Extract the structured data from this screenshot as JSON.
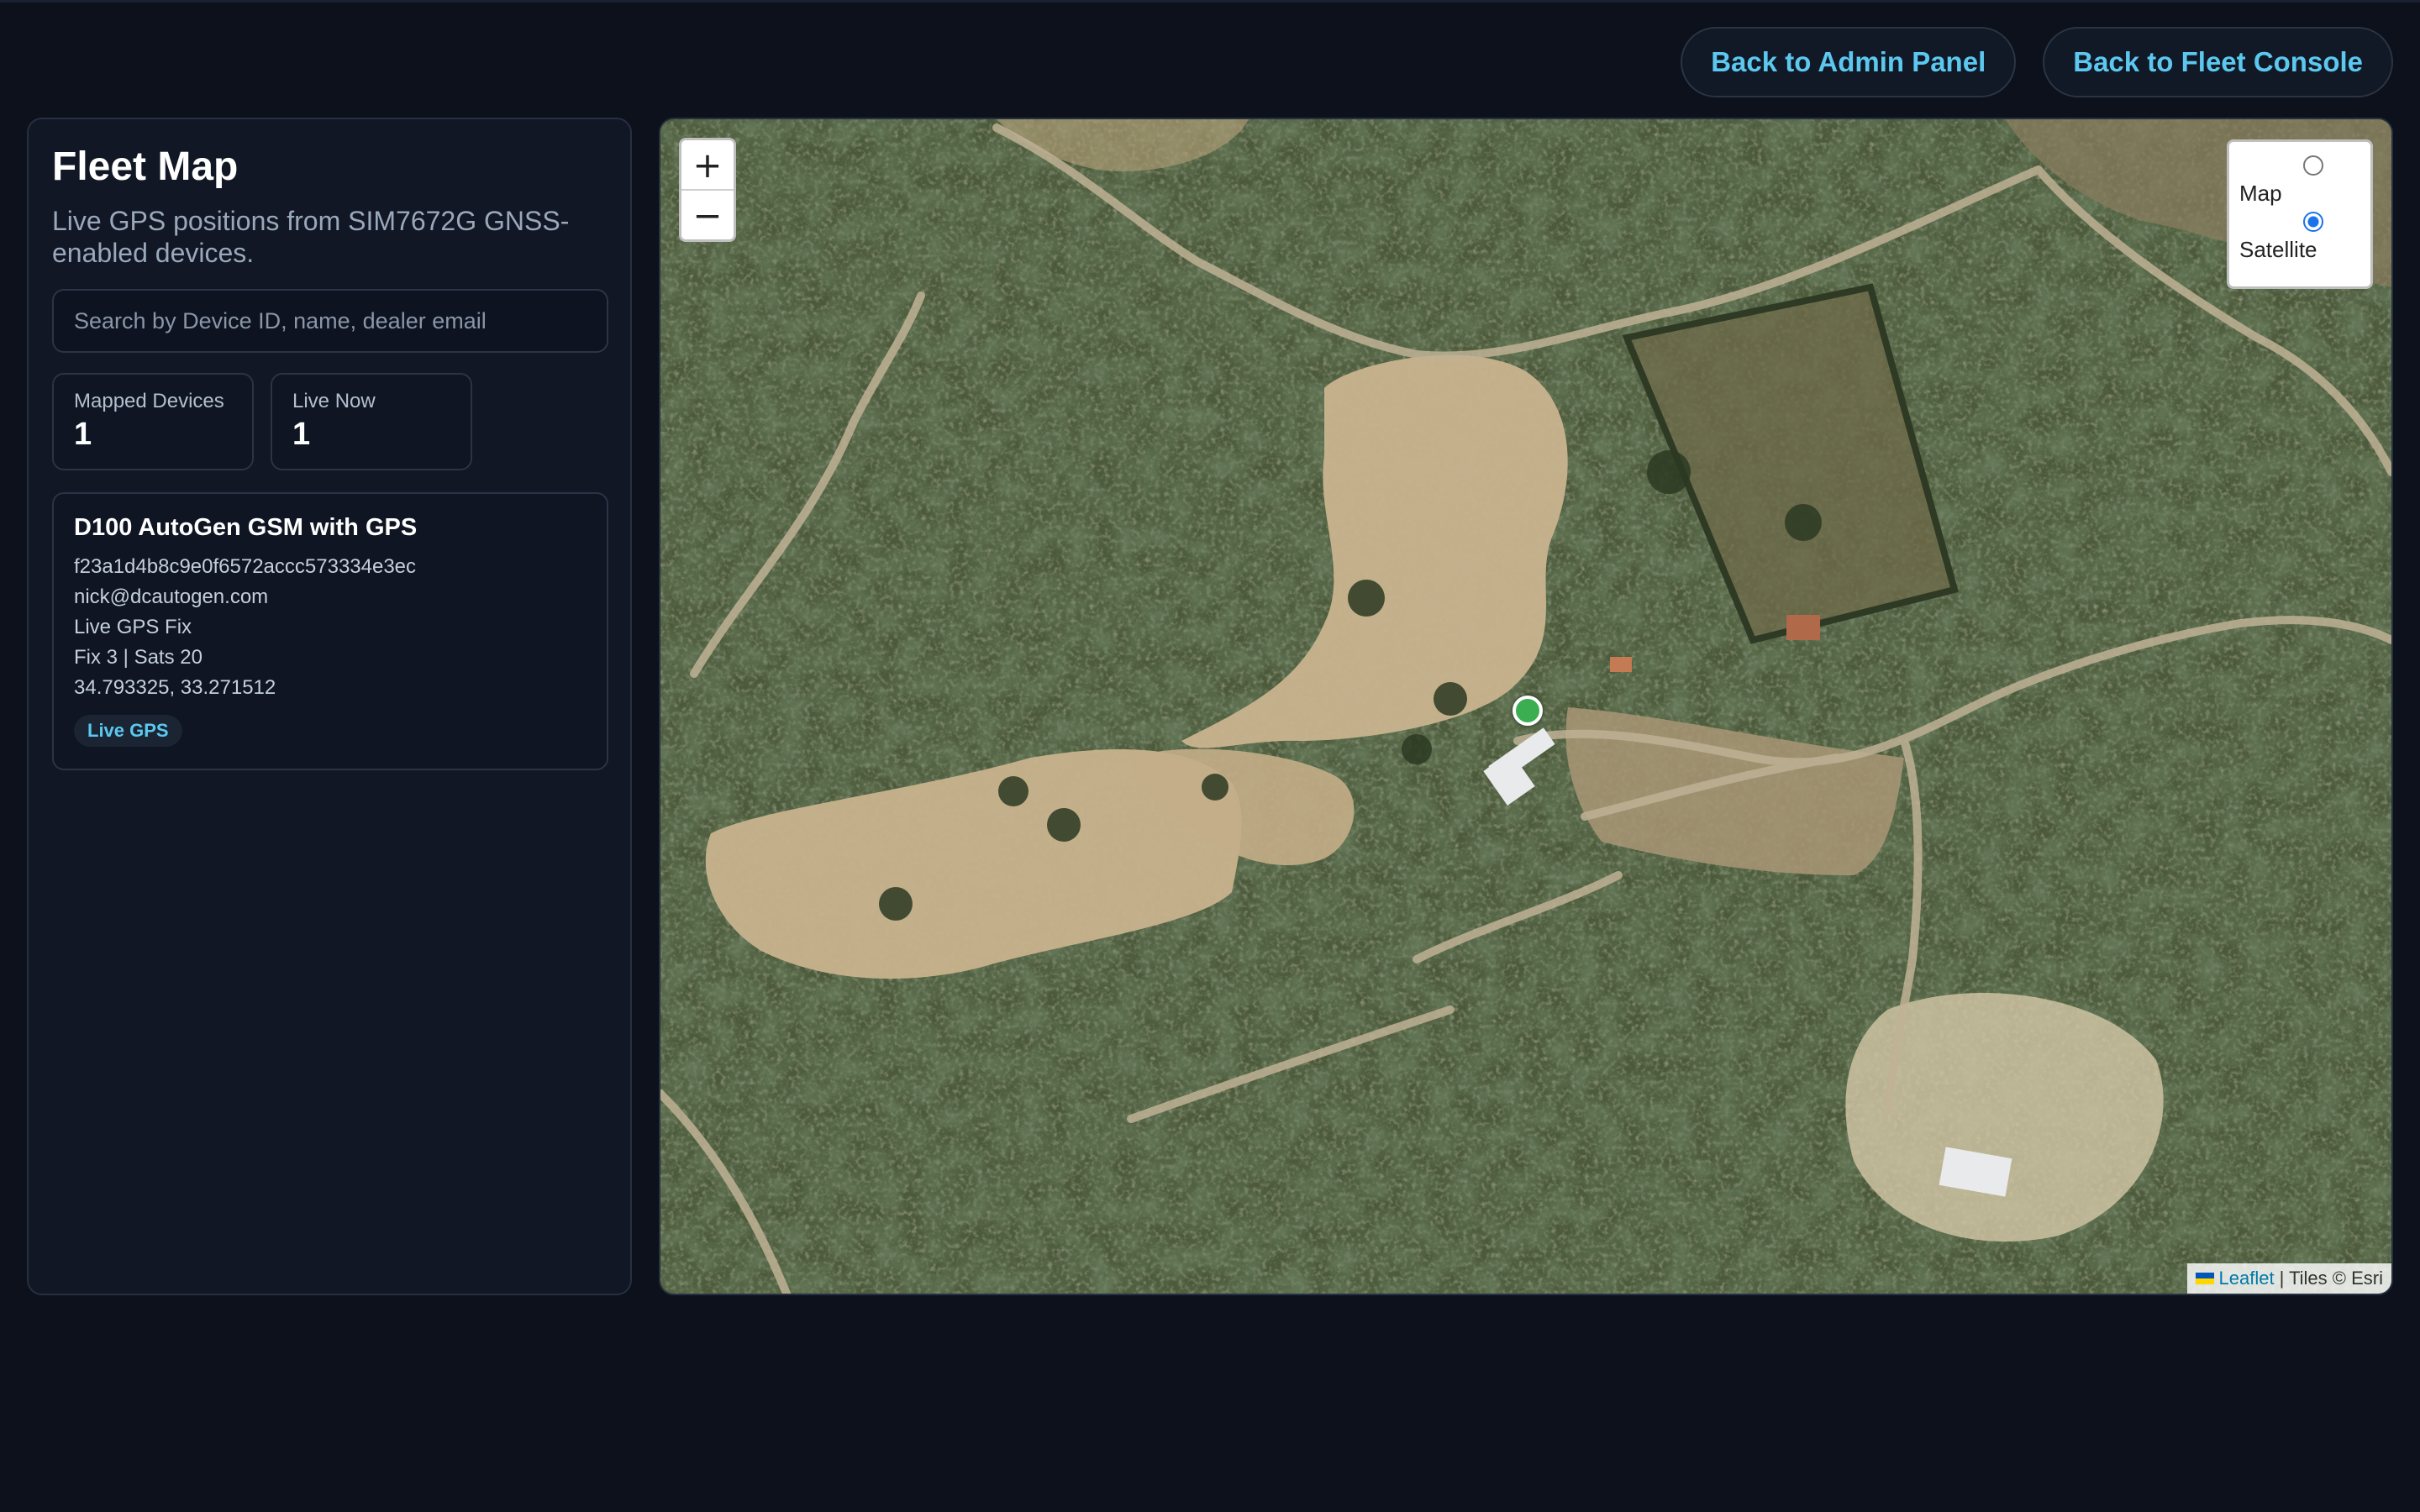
{
  "header": {
    "back_admin_label": "Back to Admin Panel",
    "back_fleet_label": "Back to Fleet Console"
  },
  "sidebar": {
    "title": "Fleet Map",
    "subtitle": "Live GPS positions from SIM7672G GNSS-enabled devices.",
    "search_placeholder": "Search by Device ID, name, dealer email",
    "search_value": "",
    "stats": [
      {
        "label": "Mapped Devices",
        "value": "1"
      },
      {
        "label": "Live Now",
        "value": "1"
      }
    ],
    "devices": [
      {
        "name": "D100 AutoGen GSM with GPS",
        "device_id": "f23a1d4b8c9e0f6572accc573334e3ec",
        "dealer_email": "nick@dcautogen.com",
        "fix_status": "Live GPS Fix",
        "fix_sats": "Fix 3 | Sats 20",
        "coordinates": "34.793325, 33.271512",
        "badge": "Live GPS",
        "marker_color": "#3cae52"
      }
    ]
  },
  "map": {
    "zoom_in_label": "+",
    "zoom_out_label": "−",
    "layers": [
      {
        "label": "Map",
        "checked": false
      },
      {
        "label": "Satellite",
        "checked": true
      }
    ],
    "attribution_link": "Leaflet",
    "attribution_text": "| Tiles © Esri"
  },
  "colors": {
    "background": "#0c111b",
    "accent": "#5cc8ef",
    "panel": "#111724"
  }
}
